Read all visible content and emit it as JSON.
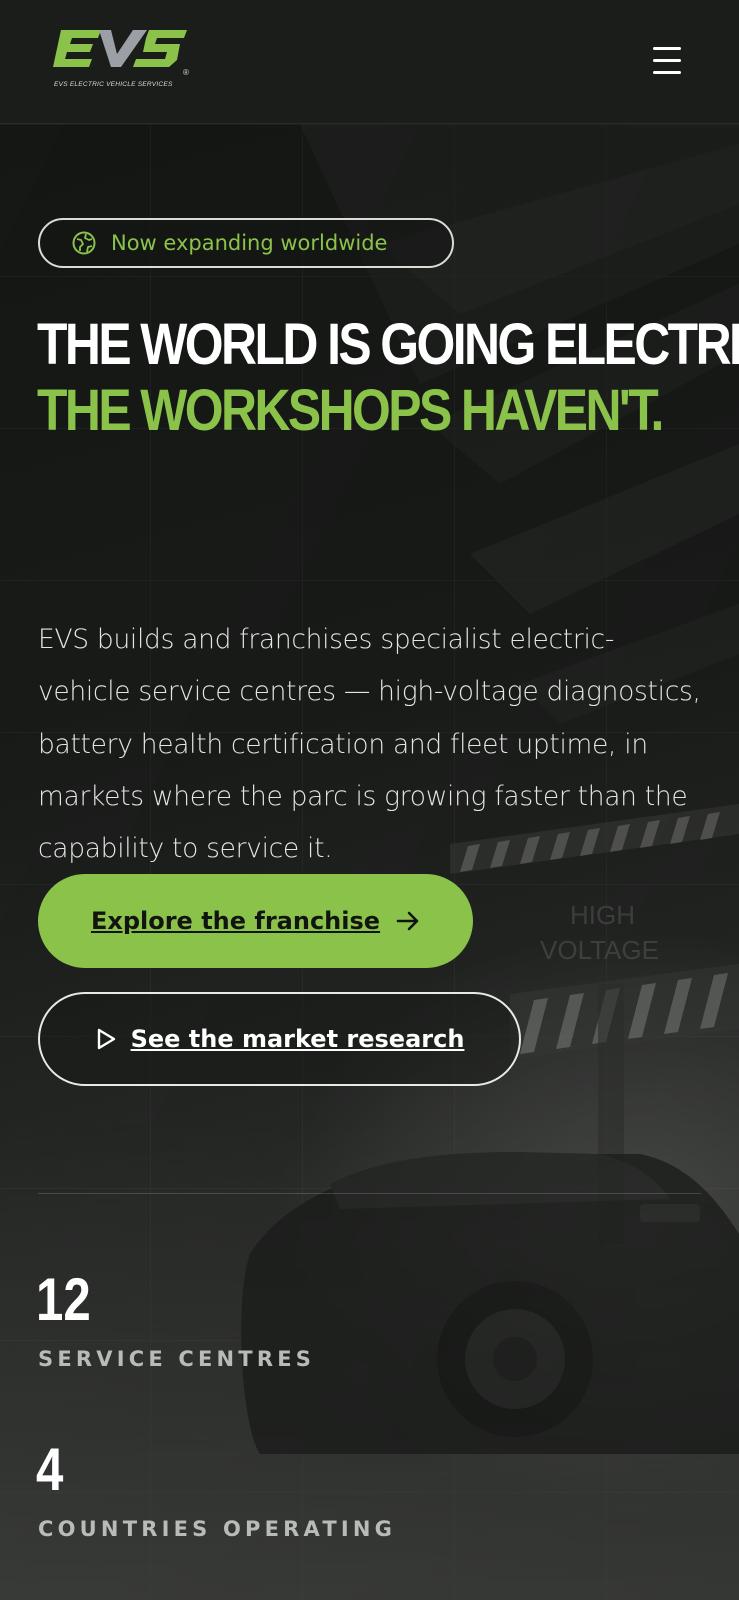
{
  "brand": {
    "logo_text": "EVS",
    "tagline": "EVS ELECTRIC VEHICLE SERVICES",
    "registered_mark": "®",
    "primary_color": "#8bc34a",
    "secondary_color": "#9aa0a6"
  },
  "header": {
    "menu_icon": "hamburger-menu-icon"
  },
  "hero": {
    "badge": {
      "icon": "globe-icon",
      "text": "Now expanding worldwide"
    },
    "headline_line1": "THE WORLD IS GOING ELECTRIC.",
    "headline_line2": "THE WORKSHOPS HAVEN'T.",
    "lede": "EVS builds and franchises specialist electric-vehicle service centres — high-voltage diagnostics, battery health certification and fleet uptime, in markets where the parc is growing faster than the capability to service it.",
    "primary_cta": {
      "label": "Explore the franchise",
      "icon": "arrow-right-icon"
    },
    "secondary_cta": {
      "label": "See the market research",
      "icon": "play-icon"
    },
    "background_sign_text": [
      "HIGH",
      "VOLTAGE"
    ]
  },
  "stats": [
    {
      "value": "12",
      "label": "SERVICE CENTRES"
    },
    {
      "value": "4",
      "label": "COUNTRIES OPERATING"
    }
  ]
}
